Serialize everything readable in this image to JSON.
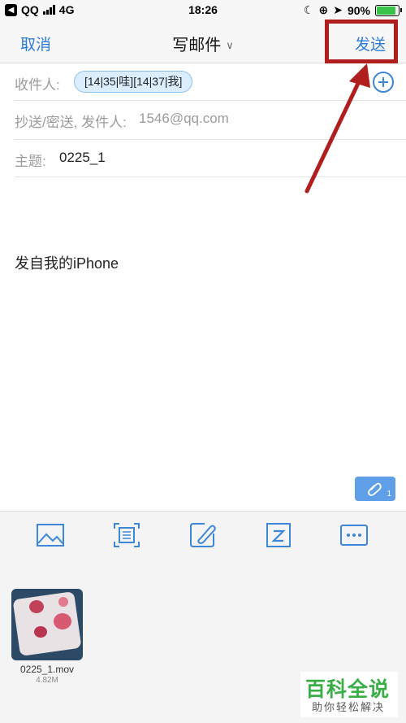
{
  "status_bar": {
    "carrier": "QQ",
    "network": "4G",
    "time": "18:26",
    "battery": "90%"
  },
  "nav": {
    "cancel_label": "取消",
    "title": "写邮件",
    "send_label": "发送"
  },
  "recipients": {
    "label": "收件人:",
    "chips": [
      "[14|35|哇][14|37|我]"
    ]
  },
  "cc": {
    "label": "抄送/密送, 发件人:",
    "value": "1546@qq.com"
  },
  "subject": {
    "label": "主题:",
    "value": "0225_1"
  },
  "body": {
    "signature": "发自我的iPhone"
  },
  "attachment_badge": {
    "count": "1"
  },
  "toolbar": {
    "icons": [
      "image-icon",
      "scan-icon",
      "edit-icon",
      "zip-icon",
      "more-icon"
    ]
  },
  "attachments": [
    {
      "name": "0225_1.mov",
      "size": "4.82M"
    }
  ],
  "watermark": {
    "main": "百科全说",
    "sub": "助你轻松解决"
  },
  "colors": {
    "accent": "#2b7bd6",
    "highlight": "#b01e1e",
    "chip_bg": "#dbeeff",
    "battery_fill": "#3ac34a",
    "watermark_green": "#3aae46"
  }
}
